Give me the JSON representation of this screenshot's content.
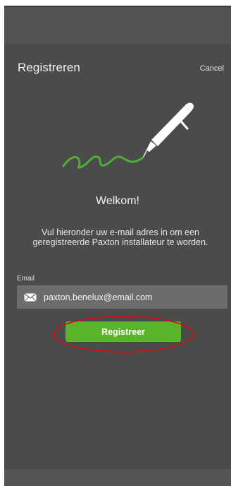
{
  "nav": {
    "title": "Registreren",
    "cancel_label": "Cancel"
  },
  "illustration": {
    "icon": "pen-signature-icon",
    "pen_color": "#ffffff",
    "squiggle_color": "#4fae34"
  },
  "welcome": "Welkom!",
  "instruction": "Vul hieronder uw e-mail adres in om een geregistreerde Paxton installateur te worden.",
  "email": {
    "label": "Email",
    "value": "paxton.benelux@email.com",
    "icon": "mail-icon"
  },
  "register": {
    "label": "Registreer",
    "color": "#5ab32b"
  },
  "highlight": {
    "color": "#d01218"
  }
}
